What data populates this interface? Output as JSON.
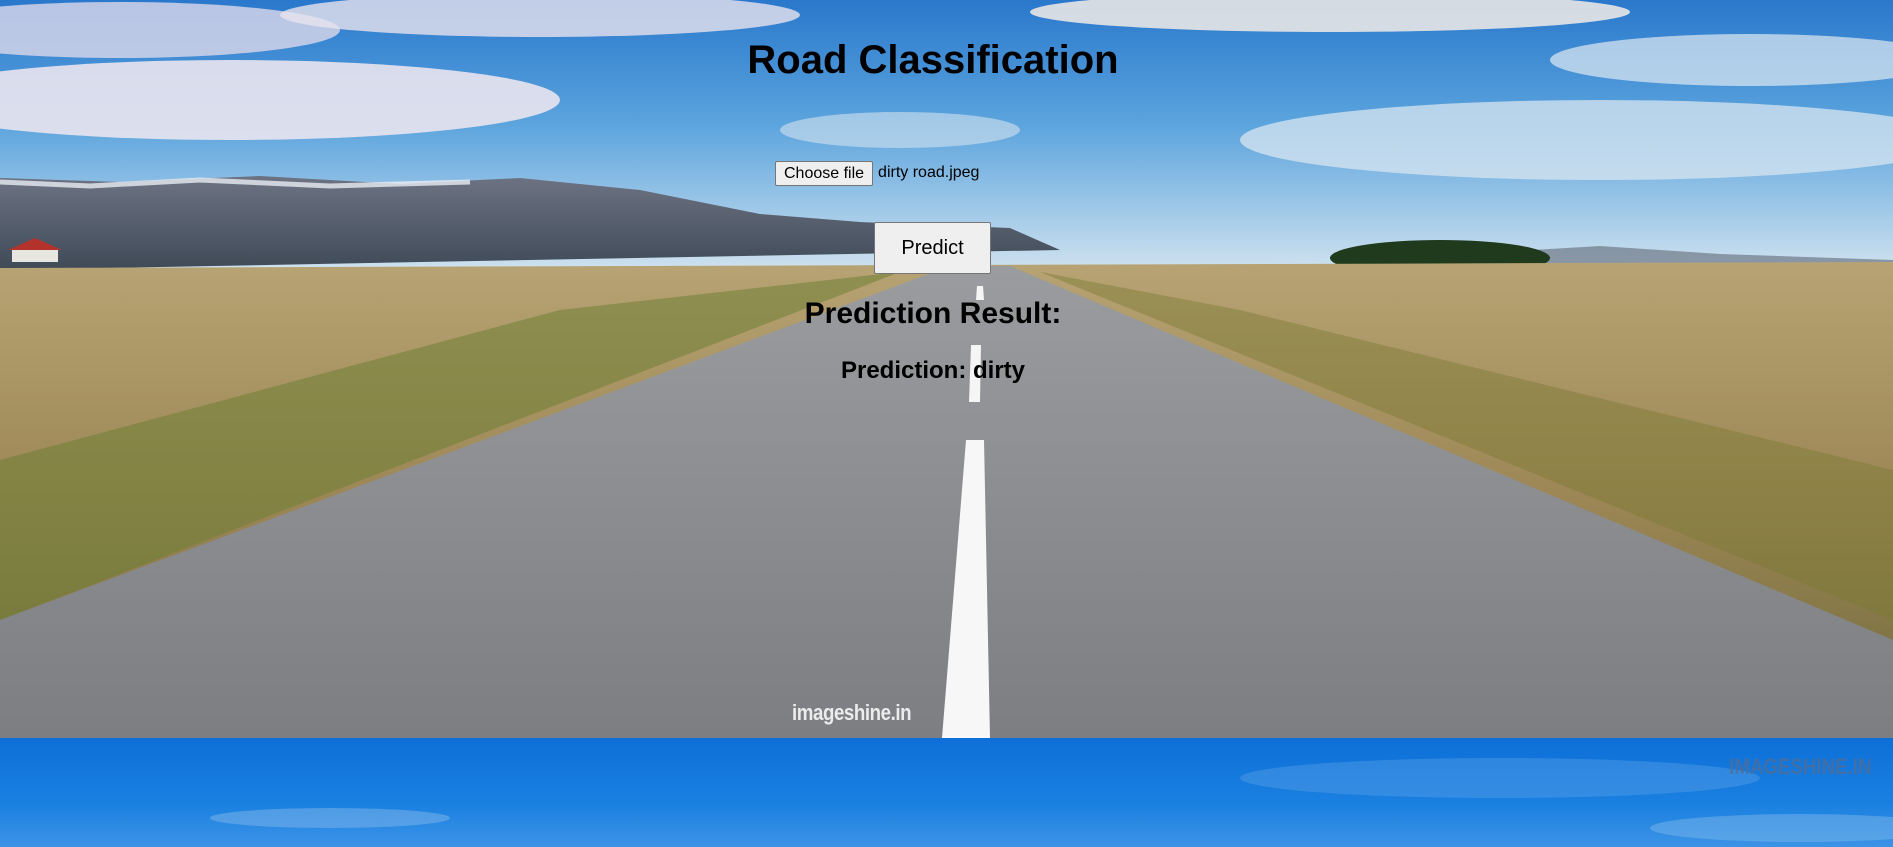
{
  "page": {
    "title": "Road Classification"
  },
  "upload": {
    "button_label": "Choose file",
    "file_name": "dirty road.jpeg"
  },
  "actions": {
    "predict_label": "Predict"
  },
  "result": {
    "heading": "Prediction Result:",
    "text": "Prediction: dirty"
  },
  "watermarks": {
    "top": "imageshine.in",
    "bottom": "IMAGESHINE.IN"
  }
}
